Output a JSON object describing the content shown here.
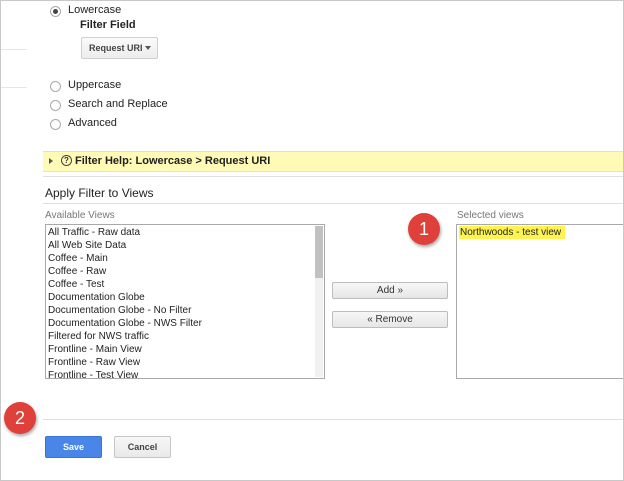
{
  "filter_type": {
    "options": [
      {
        "label": "Lowercase",
        "checked": true
      },
      {
        "label": "Uppercase",
        "checked": false
      },
      {
        "label": "Search and Replace",
        "checked": false
      },
      {
        "label": "Advanced",
        "checked": false
      }
    ],
    "filter_field_label": "Filter Field",
    "filter_field_value": "Request URI"
  },
  "help_bar": {
    "text": "Filter Help: Lowercase  >  Request URI",
    "icon": "question-circle-icon"
  },
  "apply_filter": {
    "title": "Apply Filter to Views",
    "available_label": "Available Views",
    "selected_label": "Selected views",
    "available_views": [
      "All Traffic - Raw data",
      "All Web Site Data",
      "Coffee - Main",
      "Coffee - Raw",
      "Coffee - Test",
      "Documentation Globe",
      "Documentation Globe - No Filter",
      "Documentation Globe - NWS Filter",
      "Filtered for NWS traffic",
      "Frontline - Main View",
      "Frontline - Raw View",
      "Frontline - Test View"
    ],
    "selected_views": [
      "Northwoods - test view"
    ],
    "add_label": "Add »",
    "remove_label": "« Remove"
  },
  "callouts": {
    "one": "1",
    "two": "2"
  },
  "actions": {
    "save_label": "Save",
    "cancel_label": "Cancel"
  },
  "colors": {
    "save_blue": "#4a86e8",
    "help_yellow": "#fffab5",
    "badge_red": "#e0403a",
    "highlight_yellow": "#fff44f"
  }
}
